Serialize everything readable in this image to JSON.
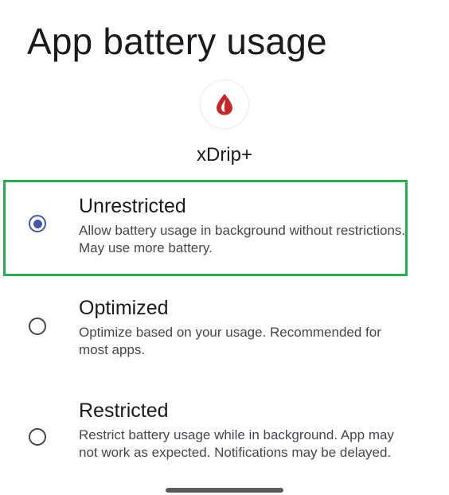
{
  "page": {
    "title": "App battery usage"
  },
  "app": {
    "icon": "xdrip-blood-drop-icon",
    "name": "xDrip+",
    "icon_color": "#c62828"
  },
  "options": [
    {
      "title": "Unrestricted",
      "description": "Allow battery usage in background without restrictions. May use more battery.",
      "selected": true
    },
    {
      "title": "Optimized",
      "description": "Optimize based on your usage. Recommended for most apps.",
      "selected": false
    },
    {
      "title": "Restricted",
      "description": "Restrict battery usage while in background. App may not work as expected. Notifications may be delayed.",
      "selected": false
    }
  ],
  "colors": {
    "radio_selected": "#4458a6",
    "highlight": "#27ae50"
  }
}
